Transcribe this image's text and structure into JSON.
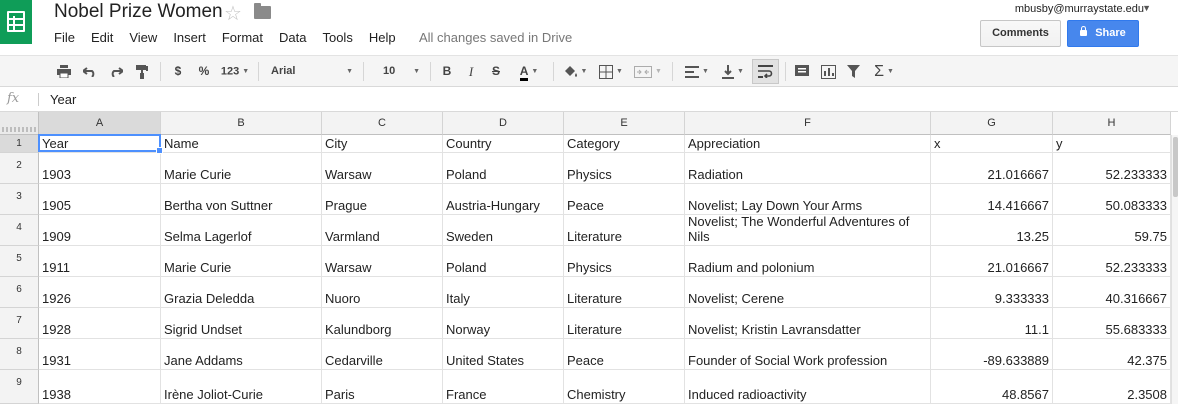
{
  "app": {
    "title": "Nobel Prize Women",
    "menus": [
      "File",
      "Edit",
      "View",
      "Insert",
      "Format",
      "Data",
      "Tools",
      "Help"
    ],
    "save_status": "All changes saved in Drive",
    "account": "mbusby@murraystate.edu",
    "comments_label": "Comments",
    "share_label": "Share",
    "brand_color": "#0f9d58",
    "share_color": "#4787ed"
  },
  "toolbar": {
    "currency": "$",
    "percent": "%",
    "number_format": "123",
    "font_family": "Arial",
    "font_size": "10",
    "bold": "B",
    "italic": "I",
    "strikethrough": "S",
    "text_color": "A",
    "sigma": "Σ"
  },
  "formula_bar": {
    "fx": "fx",
    "value": "Year"
  },
  "sheet": {
    "columns": [
      "A",
      "B",
      "C",
      "D",
      "E",
      "F",
      "G",
      "H"
    ],
    "row_numbers": [
      "1",
      "2",
      "3",
      "4",
      "5",
      "6",
      "7",
      "8",
      "9"
    ],
    "selected_cell": "A1",
    "rows": [
      [
        "Year",
        "Name",
        "City",
        "Country",
        "Category",
        "Appreciation",
        "x",
        "y"
      ],
      [
        "1903",
        "Marie Curie",
        "Warsaw",
        "Poland",
        "Physics",
        "Radiation",
        "21.016667",
        "52.233333"
      ],
      [
        "1905",
        "Bertha von Suttner",
        "Prague",
        "Austria-Hungary",
        "Peace",
        "Novelist; Lay Down Your Arms",
        "14.416667",
        "50.083333"
      ],
      [
        "1909",
        "Selma Lagerlof",
        "Varmland",
        "Sweden",
        "Literature",
        "Novelist; The Wonderful Adventures of Nils",
        "13.25",
        "59.75"
      ],
      [
        "1911",
        "Marie Curie",
        "Warsaw",
        "Poland",
        "Physics",
        "Radium and polonium",
        "21.016667",
        "52.233333"
      ],
      [
        "1926",
        "Grazia Deledda",
        "Nuoro",
        "Italy",
        "Literature",
        "Novelist; Cerene",
        "9.333333",
        "40.316667"
      ],
      [
        "1928",
        "Sigrid Undset",
        "Kalundborg",
        "Norway",
        "Literature",
        "Novelist; Kristin Lavransdatter",
        "11.1",
        "55.683333"
      ],
      [
        "1931",
        "Jane Addams",
        "Cedarville",
        "United States",
        "Peace",
        "Founder of Social Work profession",
        "-89.633889",
        "42.375"
      ],
      [
        "1938",
        "Irène Joliot-Curie",
        "Paris",
        "France",
        "Chemistry",
        "Induced radioactivity",
        "48.8567",
        "2.3508"
      ]
    ]
  }
}
